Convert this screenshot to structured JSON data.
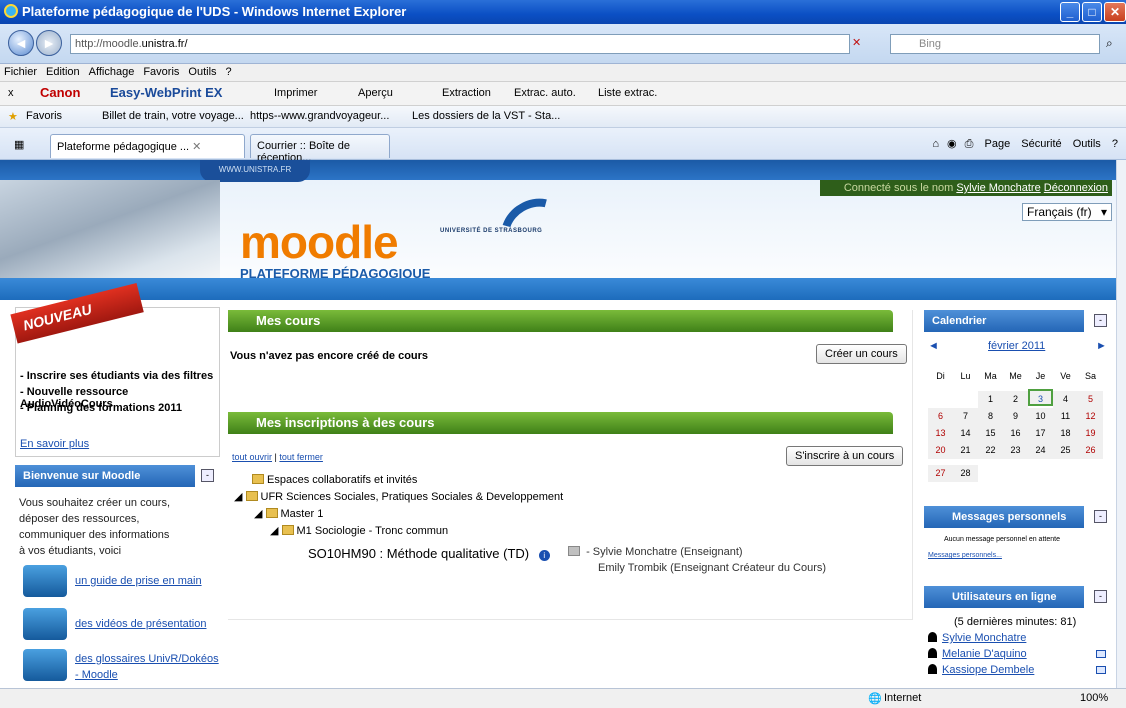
{
  "window": {
    "title": "Plateforme pédagogique de l'UDS - Windows Internet Explorer"
  },
  "address": {
    "url_prefix": "http://moodle.",
    "url_host": "unistra.fr/",
    "search_placeholder": "Bing"
  },
  "menu": [
    "Fichier",
    "Edition",
    "Affichage",
    "Favoris",
    "Outils",
    "?"
  ],
  "canon_bar": {
    "close": "x",
    "brand": "Canon",
    "product": "Easy-WebPrint EX",
    "print": "Imprimer",
    "preview": "Aperçu",
    "extraction": "Extraction",
    "auto": "Extrac. auto.",
    "list": "Liste extrac."
  },
  "favorites": {
    "label": "Favoris",
    "items": [
      "Billet de train, votre voyage...",
      "https--www.grandvoyageur...",
      "Les dossiers de la VST - Sta..."
    ]
  },
  "tabs": [
    {
      "label": "Plateforme pédagogique ...",
      "active": true
    },
    {
      "label": "Courrier :: Boîte de réception...",
      "active": false
    }
  ],
  "commands": {
    "page": "Page",
    "security": "Sécurité",
    "tools": "Outils"
  },
  "header": {
    "www": "WWW.UNISTRA.FR",
    "connected": "Connecté sous le nom",
    "user": "Sylvie Monchatre",
    "logout": "Déconnexion",
    "logo": "moodle",
    "subtitle": "PLATEFORME PÉDAGOGIQUE",
    "university": "UNIVERSITÉ DE STRASBOURG",
    "language": "Français (fr)"
  },
  "nouveau": {
    "ribbon": "NOUVEAU",
    "items": [
      "- Inscrire ses étudiants via des filtres",
      "- Nouvelle ressource AudioVidéoCours",
      "- Planning des formations 2011"
    ],
    "more": "En savoir plus"
  },
  "welcome": {
    "title": "Bienvenue sur Moodle",
    "lines": [
      "Vous souhaitez créer un cours,",
      "déposer des ressources,",
      "communiquer des informations",
      "à vos étudiants, voici"
    ],
    "links": [
      "un guide de prise en main",
      "des vidéos de présentation",
      "des glossaires UnivR/Dokéos",
      "- Moodle"
    ]
  },
  "mes_cours": {
    "title": "Mes cours",
    "empty": "Vous n'avez pas encore créé de cours",
    "create_button": "Créer un cours"
  },
  "inscriptions": {
    "title": "Mes inscriptions à des cours",
    "open_all": "tout ouvrir",
    "sep": "|",
    "close_all": "tout fermer",
    "enrol_button": "S'inscrire à un cours",
    "tree": [
      "Espaces collaboratifs et invités",
      "UFR Sciences Sociales, Pratiques Sociales & Developpement",
      "Master 1",
      "M1 Sociologie - Tronc commun"
    ],
    "course_code": "SO10HM90",
    "course_name": ": Méthode qualitative (TD)",
    "teachers": [
      "- Sylvie Monchatre (Enseignant)",
      "Emily Trombik (Enseignant Créateur du Cours)"
    ]
  },
  "calendar": {
    "title": "Calendrier",
    "month": "février 2011",
    "prev": "◄",
    "next": "►",
    "weekdays": [
      "Di",
      "Lu",
      "Ma",
      "Me",
      "Je",
      "Ve",
      "Sa"
    ],
    "weeks": [
      [
        "",
        "",
        "1",
        "2",
        "3",
        "4",
        "5"
      ],
      [
        "6",
        "7",
        "8",
        "9",
        "10",
        "11",
        "12"
      ],
      [
        "13",
        "14",
        "15",
        "16",
        "17",
        "18",
        "19"
      ],
      [
        "20",
        "21",
        "22",
        "23",
        "24",
        "25",
        "26"
      ],
      [
        "27",
        "28",
        "",
        "",
        "",
        "",
        ""
      ]
    ],
    "today": "3"
  },
  "messages": {
    "title": "Messages personnels",
    "empty": "Aucun message personnel en attente",
    "link": "Messages personnels..."
  },
  "online": {
    "title": "Utilisateurs en ligne",
    "summary": "(5 dernières minutes: 81)",
    "users": [
      "Sylvie Monchatre",
      "Melanie D'aquino",
      "Kassiope Dembele"
    ]
  },
  "status": {
    "zone": "Internet",
    "zoom": "100%"
  }
}
